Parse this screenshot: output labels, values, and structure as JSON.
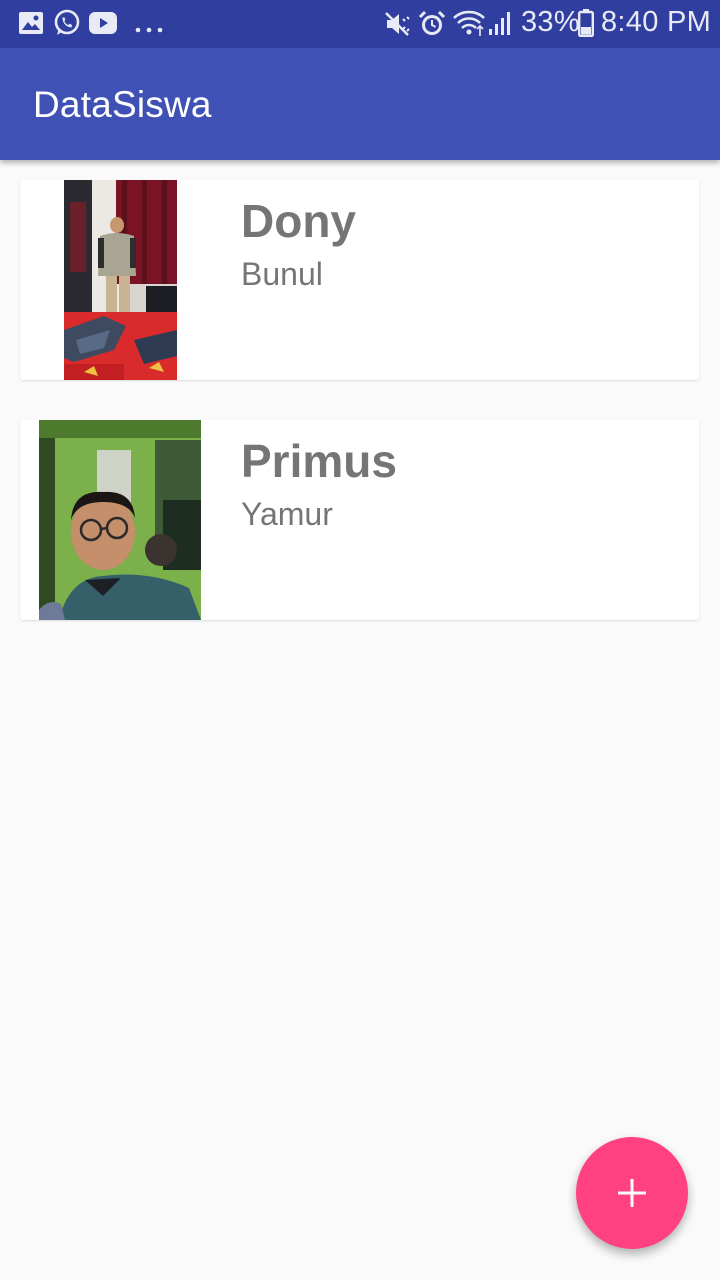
{
  "status_bar": {
    "left_icons": [
      "gallery-icon",
      "whatsapp-icon",
      "youtube-icon",
      "more-notifications-icon"
    ],
    "right_icons": [
      "mute-icon",
      "alarm-icon",
      "wifi-icon",
      "signal-icon",
      "battery-icon"
    ],
    "battery_percent": "33%",
    "time": "8:40 PM"
  },
  "app_bar": {
    "title": "DataSiswa"
  },
  "students": [
    {
      "name": "Dony",
      "subtitle": "Bunul",
      "photo": "student-photo"
    },
    {
      "name": "Primus",
      "subtitle": "Yamur",
      "photo": "student-photo"
    }
  ],
  "fab": {
    "icon": "add-icon"
  },
  "colors": {
    "status_bar": "#303f9f",
    "primary": "#3f51b5",
    "accent": "#ff4081",
    "background": "#fafafa",
    "text_secondary": "#757575"
  }
}
